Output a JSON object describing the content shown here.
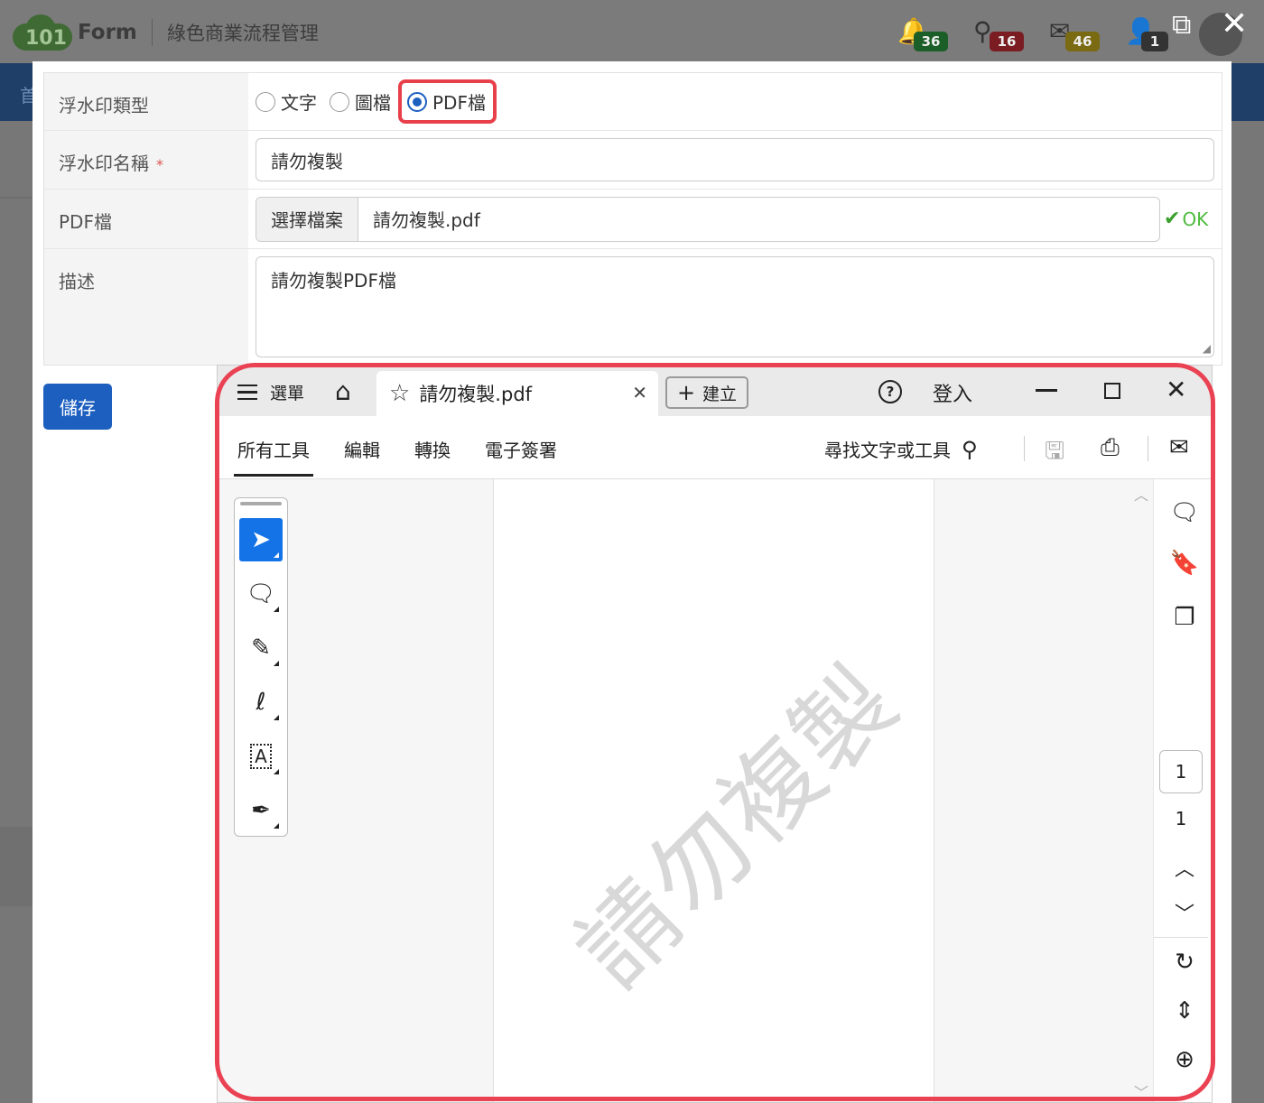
{
  "header": {
    "logo_number": "101",
    "logo_text": "Form",
    "subtitle": "綠色商業流程管理",
    "notifications": [
      {
        "icon": "bell-icon",
        "glyph": "🔔",
        "count": "36",
        "color": "#1c5e27"
      },
      {
        "icon": "stamp-icon",
        "glyph": "⚲",
        "count": "16",
        "color": "#7a1c22"
      },
      {
        "icon": "mail-icon",
        "glyph": "✉",
        "count": "46",
        "color": "#7a6a12"
      },
      {
        "icon": "user-icon",
        "glyph": "👤",
        "count": "1",
        "color": "#333333"
      }
    ],
    "left_char": "首",
    "external_icon": "⧉",
    "close_icon": "✕"
  },
  "form": {
    "watermark_type": {
      "label": "浮水印類型",
      "options": [
        {
          "label": "文字",
          "selected": false
        },
        {
          "label": "圖檔",
          "selected": false
        },
        {
          "label": "PDF檔",
          "selected": true
        }
      ]
    },
    "watermark_name": {
      "label": "浮水印名稱",
      "required_mark": "*",
      "value": "請勿複製"
    },
    "pdf_file": {
      "label": "PDF檔",
      "button": "選擇檔案",
      "filename": "請勿複製.pdf",
      "status": "OK"
    },
    "description": {
      "label": "描述",
      "value": "請勿複製PDF檔"
    },
    "save_label": "儲存"
  },
  "viewer": {
    "menu_label": "選單",
    "tab_title": "請勿複製.pdf",
    "create_label": "建立",
    "help_label": "?",
    "login_label": "登入",
    "tools": [
      "所有工具",
      "編輯",
      "轉換",
      "電子簽署"
    ],
    "active_tool": "所有工具",
    "search_placeholder": "尋找文字或工具",
    "watermark_text": "請勿複製",
    "page_current": "1",
    "page_total": "1",
    "accent_color": "#1473e6",
    "highlight_color": "#ea4252"
  }
}
